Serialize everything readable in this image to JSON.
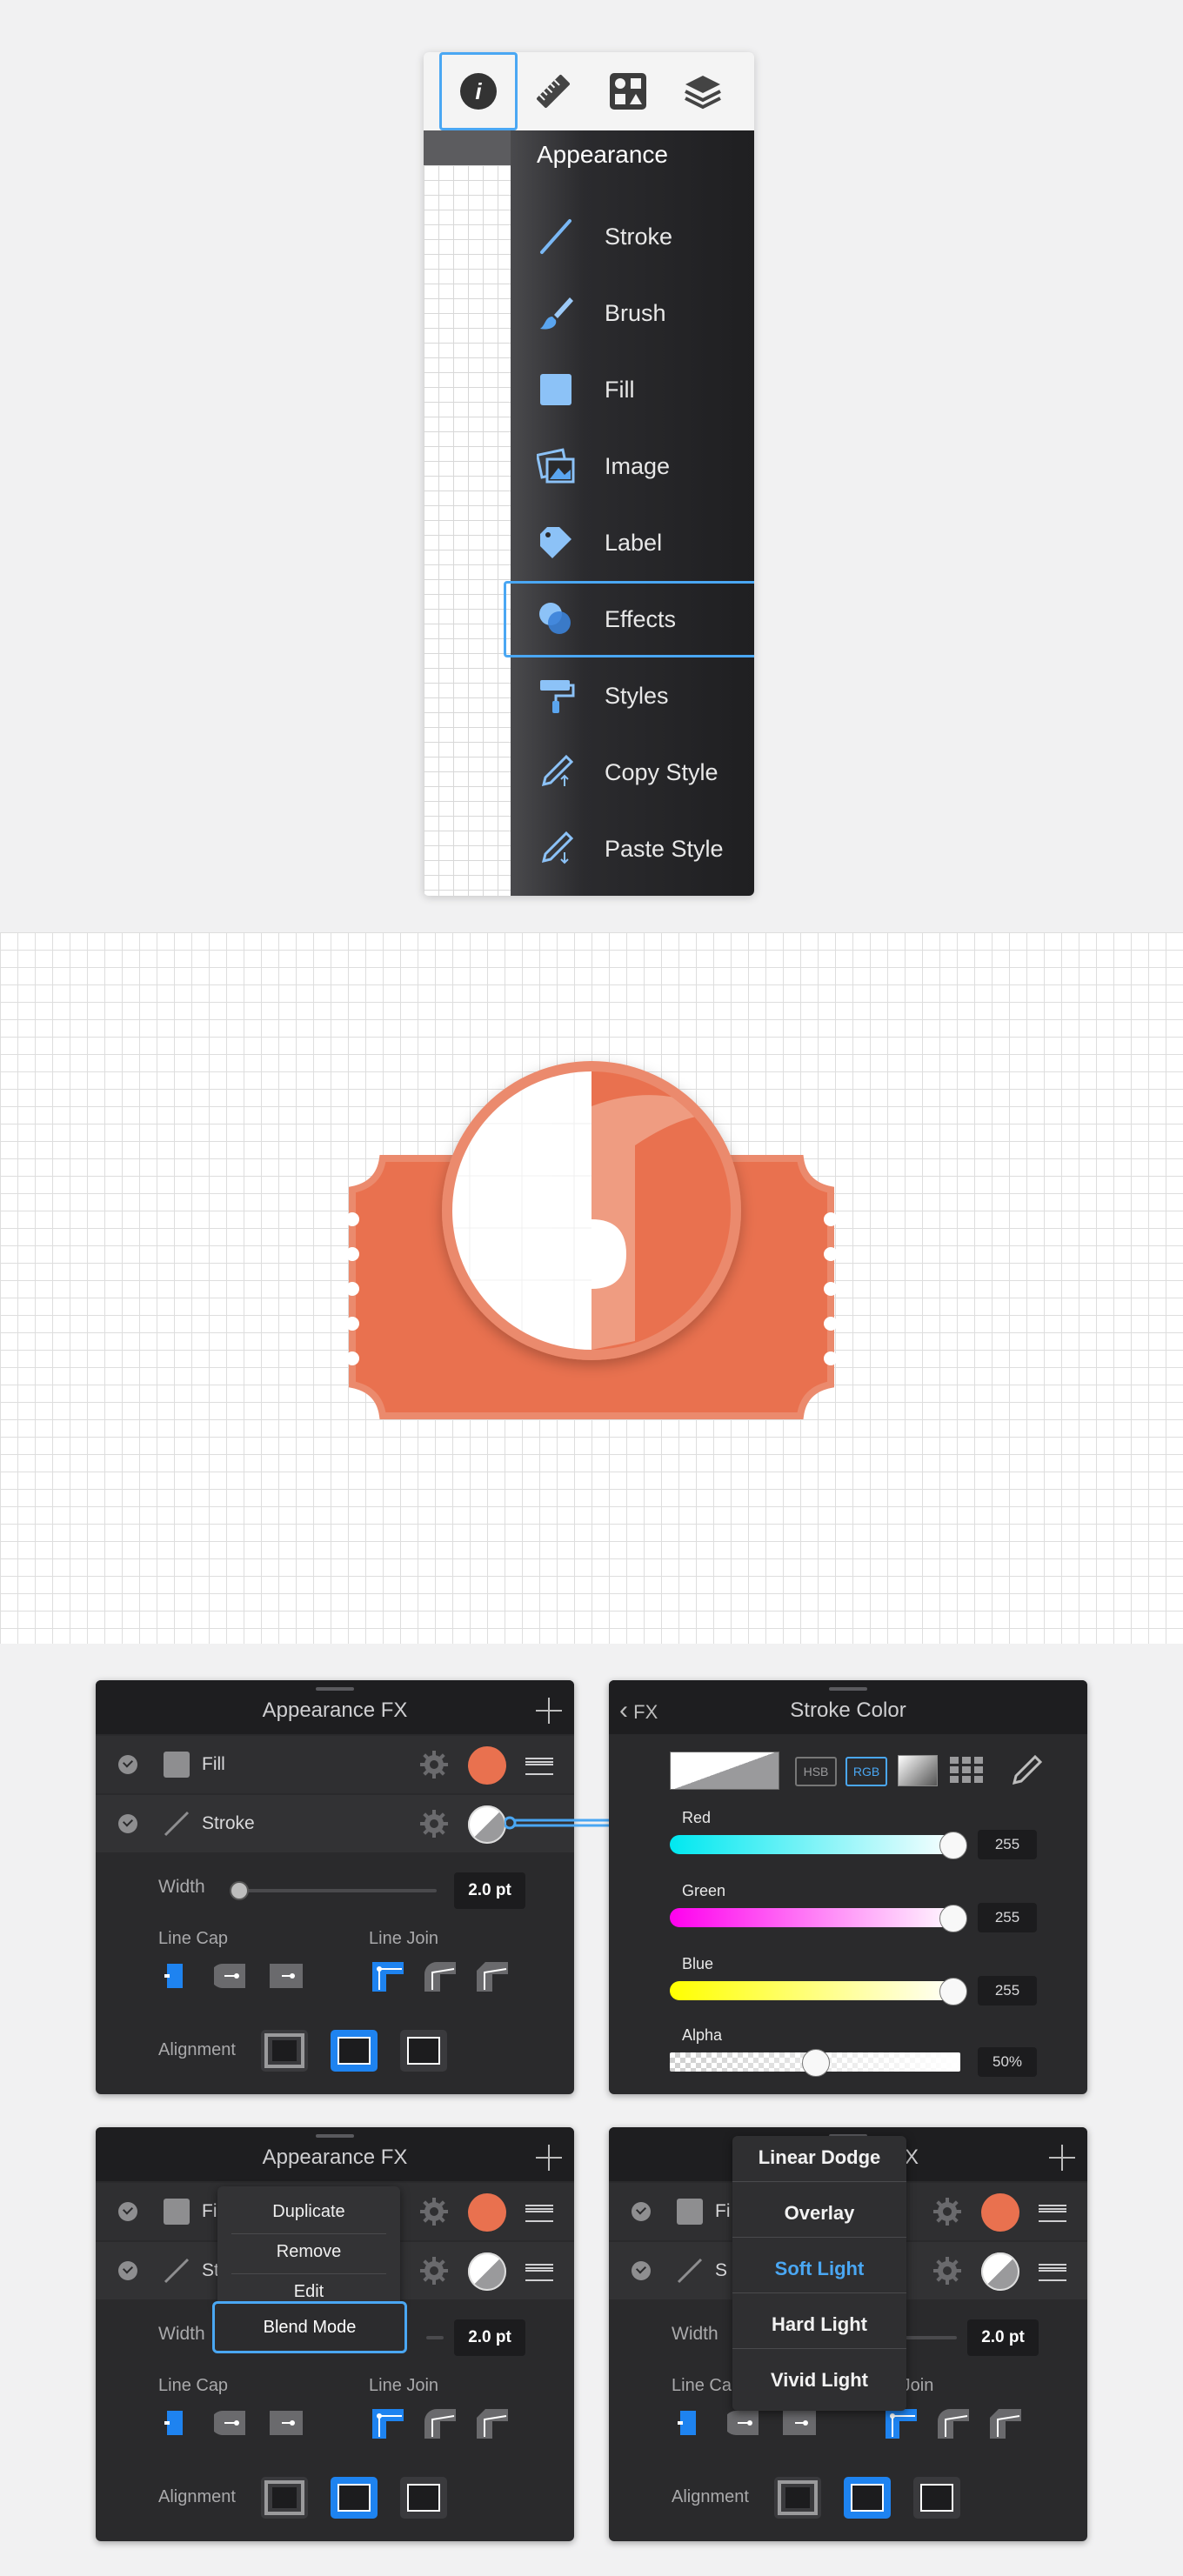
{
  "menu": {
    "title": "Appearance",
    "items": [
      {
        "label": "Stroke",
        "icon": "stroke-line-icon"
      },
      {
        "label": "Brush",
        "icon": "brush-icon"
      },
      {
        "label": "Fill",
        "icon": "fill-square-icon"
      },
      {
        "label": "Image",
        "icon": "image-icon"
      },
      {
        "label": "Label",
        "icon": "label-tag-icon"
      },
      {
        "label": "Effects",
        "icon": "effects-circles-icon",
        "selected": true
      },
      {
        "label": "Styles",
        "icon": "paint-roller-icon"
      },
      {
        "label": "Copy Style",
        "icon": "eyedropper-up-icon"
      },
      {
        "label": "Paste Style",
        "icon": "eyedropper-down-icon"
      }
    ],
    "toolbar": [
      "info-icon",
      "ruler-icon",
      "shapes-icon",
      "layers-icon"
    ]
  },
  "fx": {
    "title": "Appearance FX",
    "rows": [
      {
        "label": "Fill",
        "color": "#e9714f"
      },
      {
        "label": "Stroke",
        "color": "#ffffff"
      }
    ],
    "width_label": "Width",
    "width_value": "2.0 pt",
    "line_cap": "Line Cap",
    "line_join": "Line Join",
    "alignment": "Alignment"
  },
  "stroke_color": {
    "back": "FX",
    "title": "Stroke Color",
    "mode_hsb": "HSB",
    "mode_rgb": "RGB",
    "channels": [
      {
        "label": "Red",
        "value": "255",
        "level": 1.0
      },
      {
        "label": "Green",
        "value": "255",
        "level": 1.0
      },
      {
        "label": "Blue",
        "value": "255",
        "level": 1.0
      },
      {
        "label": "Alpha",
        "value": "50%",
        "level": 0.5
      }
    ]
  },
  "context_menu": {
    "items": [
      "Duplicate",
      "Remove",
      "Edit",
      "Blend Mode"
    ],
    "row_fill_partial": "Fi",
    "row_stroke_partial": "St"
  },
  "blend_modes": {
    "items": [
      "Linear Dodge",
      "Overlay",
      "Soft Light",
      "Hard Light",
      "Vivid Light"
    ],
    "selected": "Soft Light",
    "title_partial": "X",
    "row_fill_partial": "Fi",
    "row_stroke_partial": "S",
    "line_cap_partial": "Line Ca",
    "line_join_partial": "e Join"
  },
  "colors": {
    "accent": "#4aa7f3",
    "ticket": "#e9714f",
    "panel_bg": "#2a2a2c"
  }
}
